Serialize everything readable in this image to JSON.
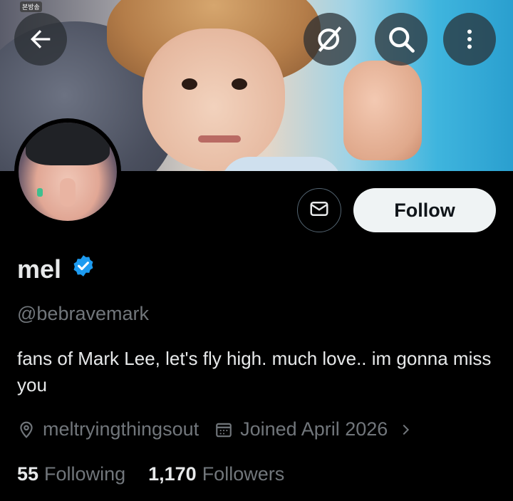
{
  "banner": {
    "tag": "본방송"
  },
  "profile": {
    "name": "mel",
    "handle": "@bebravemark",
    "bio": "fans of Mark Lee, let's fly high. much love.. im gonna miss you",
    "location_icon": "map-pin-icon",
    "website": "meltryingthingsout",
    "joined_icon": "calendar-icon",
    "joined": "Joined April 2026",
    "following_count": "55",
    "following_label": "Following",
    "followers_count": "1,170",
    "followers_label": "Followers"
  },
  "actions": {
    "follow_label": "Follow",
    "message_icon": "envelope-icon"
  },
  "top_bar": {
    "back_icon": "arrow-left-icon",
    "grok_icon": "grok-icon",
    "search_icon": "search-icon",
    "more_icon": "more-vertical-icon"
  },
  "colors": {
    "background": "#000000",
    "verified": "#1d9bf0",
    "follow_bg": "#eff3f4",
    "muted": "#71767b"
  }
}
